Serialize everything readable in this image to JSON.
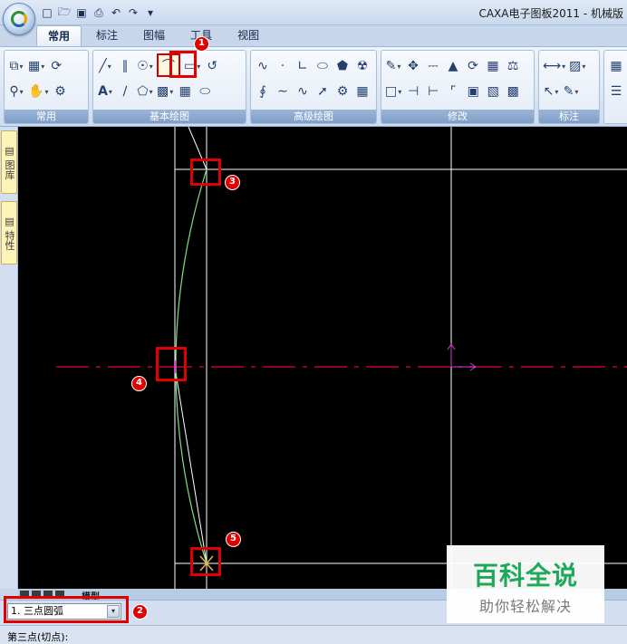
{
  "window": {
    "title": "CAXA电子图板2011 - 机械版"
  },
  "ribbon": {
    "tabs": [
      {
        "label": "常用",
        "active": true
      },
      {
        "label": "标注",
        "active": false
      },
      {
        "label": "图幅",
        "active": false
      },
      {
        "label": "工具",
        "active": false
      },
      {
        "label": "视图",
        "active": false
      }
    ],
    "groups": {
      "common": "常用",
      "basic_draw": "基本绘图",
      "advanced_draw": "高级绘图",
      "modify": "修改",
      "annotate": "标注"
    },
    "selected_tool_icon": "arc-icon"
  },
  "leftstrip": {
    "tab1": "图库",
    "tab2": "特性"
  },
  "layout_tab": "模型",
  "command": {
    "mode_value": "1. 三点圆弧"
  },
  "status": {
    "prompt": "第三点(切点):"
  },
  "annotations": [
    "1",
    "2",
    "3",
    "4",
    "5"
  ],
  "watermark": {
    "title": "百科全说",
    "subtitle": "助你轻松解决"
  },
  "colors": {
    "canvas_background": "#000000",
    "construction_lines": "#ffffff",
    "arc": "#7ee07e",
    "centerline": "#c0003a",
    "ucs_axes": "#d040d0",
    "annotation_red": "#e00000",
    "watermark_green": "#1ea85a"
  }
}
